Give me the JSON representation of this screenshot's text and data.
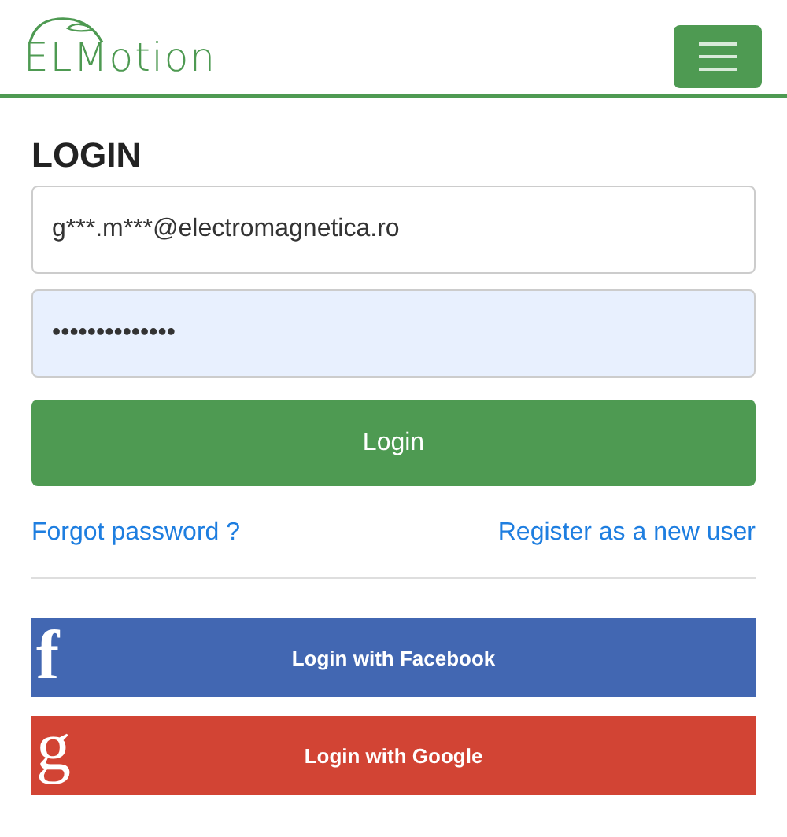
{
  "logo": {
    "text": "ELMotion"
  },
  "title": "LOGIN",
  "email": {
    "value": "g***.m***@electromagnetica.ro"
  },
  "password": {
    "value": "••••••••••••••"
  },
  "login_button": "Login",
  "links": [
    {
      "label": "Forgot password ?"
    },
    {
      "label": "Register as a new user"
    }
  ],
  "social": [
    {
      "kind": "facebook",
      "icon": "f",
      "label": "Login with Facebook",
      "color": "#4267b2"
    },
    {
      "kind": "google",
      "icon": "g",
      "label": "Login with Google",
      "color": "#d24434"
    }
  ]
}
